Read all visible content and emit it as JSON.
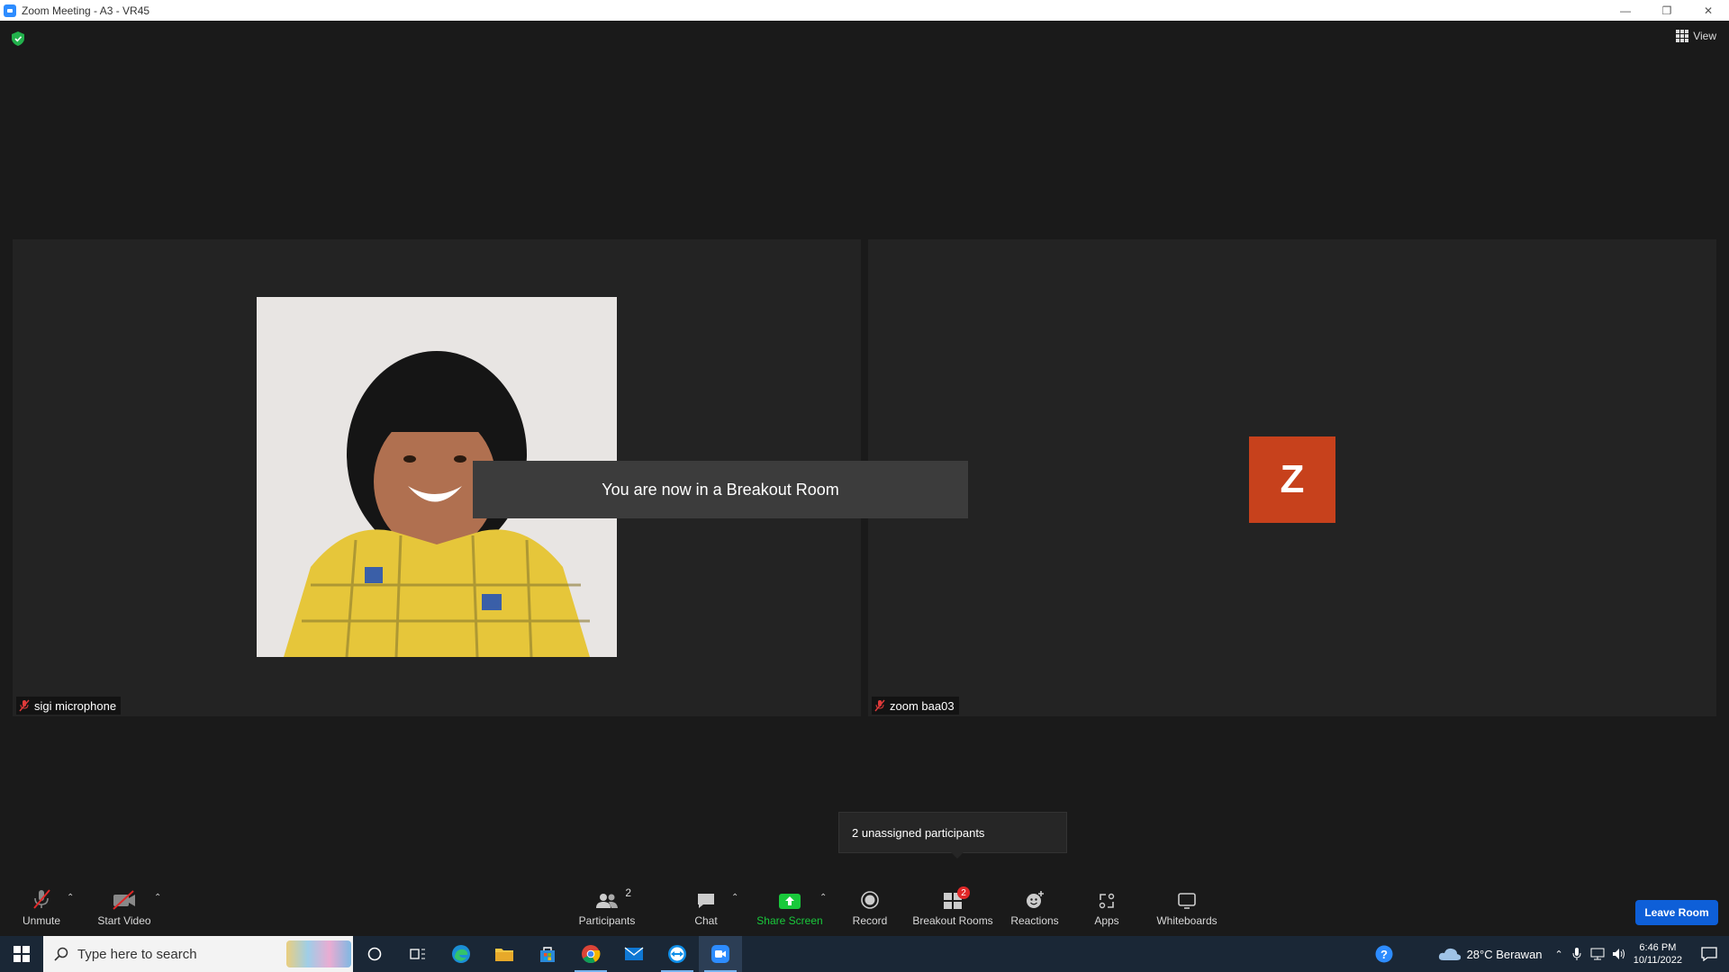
{
  "window": {
    "title": "Zoom Meeting - A3 - VR45"
  },
  "meeting": {
    "view_label": "View",
    "toast": "You are now in a Breakout Room",
    "tiles": [
      {
        "name": "sigi microphone",
        "muted": true,
        "type": "photo"
      },
      {
        "name": "zoom baa03",
        "muted": true,
        "type": "avatar",
        "avatar_letter": "Z",
        "avatar_color": "#c7411c"
      }
    ],
    "tooltip": "2 unassigned participants"
  },
  "toolbar": {
    "unmute": "Unmute",
    "start_video": "Start Video",
    "participants": "Participants",
    "participants_count": "2",
    "chat": "Chat",
    "share_screen": "Share Screen",
    "record": "Record",
    "breakout_rooms": "Breakout Rooms",
    "breakout_badge": "2",
    "reactions": "Reactions",
    "apps": "Apps",
    "whiteboards": "Whiteboards",
    "leave": "Leave Room"
  },
  "taskbar": {
    "search_placeholder": "Type here to search",
    "weather": "28°C  Berawan",
    "time": "6:46 PM",
    "date": "10/11/2022"
  },
  "colors": {
    "accent_blue": "#0e5fd8",
    "share_green": "#19c93b",
    "badge_red": "#e02828"
  }
}
